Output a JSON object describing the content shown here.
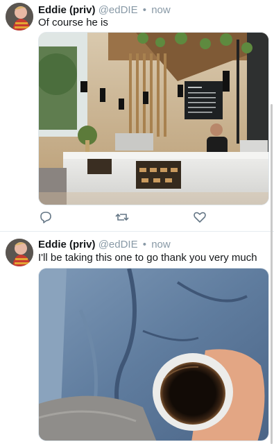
{
  "tweets": [
    {
      "author_name": "Eddie (priv)",
      "handle": "@edDIE",
      "separator": "•",
      "time": "now",
      "text": "Of course he is",
      "media_alt": "cafe-counter-photo"
    },
    {
      "author_name": "Eddie (priv)",
      "handle": "@edDIE",
      "separator": "•",
      "time": "now",
      "text": "I'll be taking this one to go thank you very much",
      "media_alt": "coffee-cup-photo"
    }
  ],
  "icons": {
    "reply": "reply-icon",
    "retweet": "retweet-icon",
    "like": "heart-icon"
  },
  "colors": {
    "meta_gray": "#8899a6",
    "text": "#14171a",
    "icon_gray": "#657786",
    "divider": "#e6ecf0"
  }
}
